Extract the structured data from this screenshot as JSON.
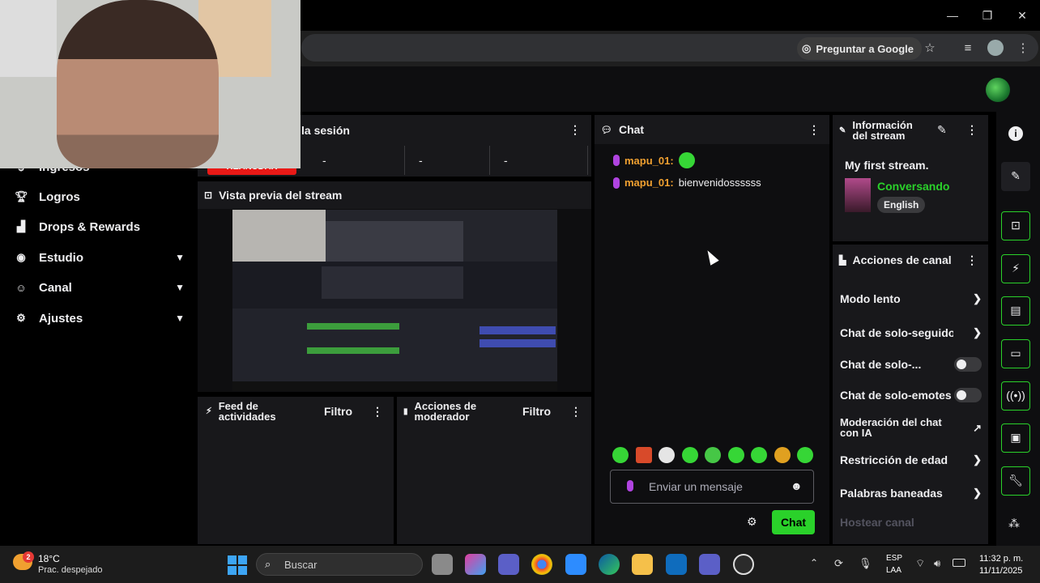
{
  "browser": {
    "ask_google": "Preguntar a Google"
  },
  "sidebar": {
    "items": [
      {
        "label": "Ingresos"
      },
      {
        "label": "Logros"
      },
      {
        "label": "Drops & Rewards"
      },
      {
        "label": "Estudio"
      },
      {
        "label": "Canal"
      },
      {
        "label": "Ajustes"
      }
    ],
    "session_badge": "REANUDAR"
  },
  "session": {
    "title": "la sesión",
    "stats": [
      "-",
      "-",
      "-"
    ]
  },
  "preview": {
    "title": "Vista previa del stream"
  },
  "activity": {
    "title": "Feed de actividades",
    "filter": "Filtro"
  },
  "moderator": {
    "title": "Acciones de moderador",
    "filter": "Filtro"
  },
  "chat": {
    "title": "Chat",
    "messages": [
      {
        "user": "mapu_01:",
        "text": ""
      },
      {
        "user": "mapu_01:",
        "text": "bienvenidossssss"
      }
    ],
    "input_placeholder": "Enviar un mensaje",
    "send_label": "Chat"
  },
  "stream_info": {
    "title": "Información del stream",
    "stream_title": "My first stream.",
    "category": "Conversando",
    "language": "English"
  },
  "channel_actions": {
    "title": "Acciones de canal",
    "rows": [
      {
        "label": "Modo lento"
      },
      {
        "label": "Chat de solo-seguidore:"
      },
      {
        "label": "Chat de solo-..."
      },
      {
        "label": "Chat de solo-emotes"
      },
      {
        "label": "Moderación del chat con IA"
      },
      {
        "label": "Restricción de edad"
      },
      {
        "label": "Palabras baneadas"
      },
      {
        "label": "Hostear canal"
      }
    ]
  },
  "taskbar": {
    "weather_temp": "18°C",
    "weather_desc": "Prac. despejado",
    "weather_badge": "2",
    "search_placeholder": "Buscar",
    "lang_1": "ESP",
    "lang_2": "LAA",
    "time": "11:32 p. m.",
    "date": "11/11/2025"
  },
  "colors": {
    "accent": "#2ad12a",
    "panel": "#18181b",
    "username": "#f0a030",
    "category": "#2ad12a"
  }
}
